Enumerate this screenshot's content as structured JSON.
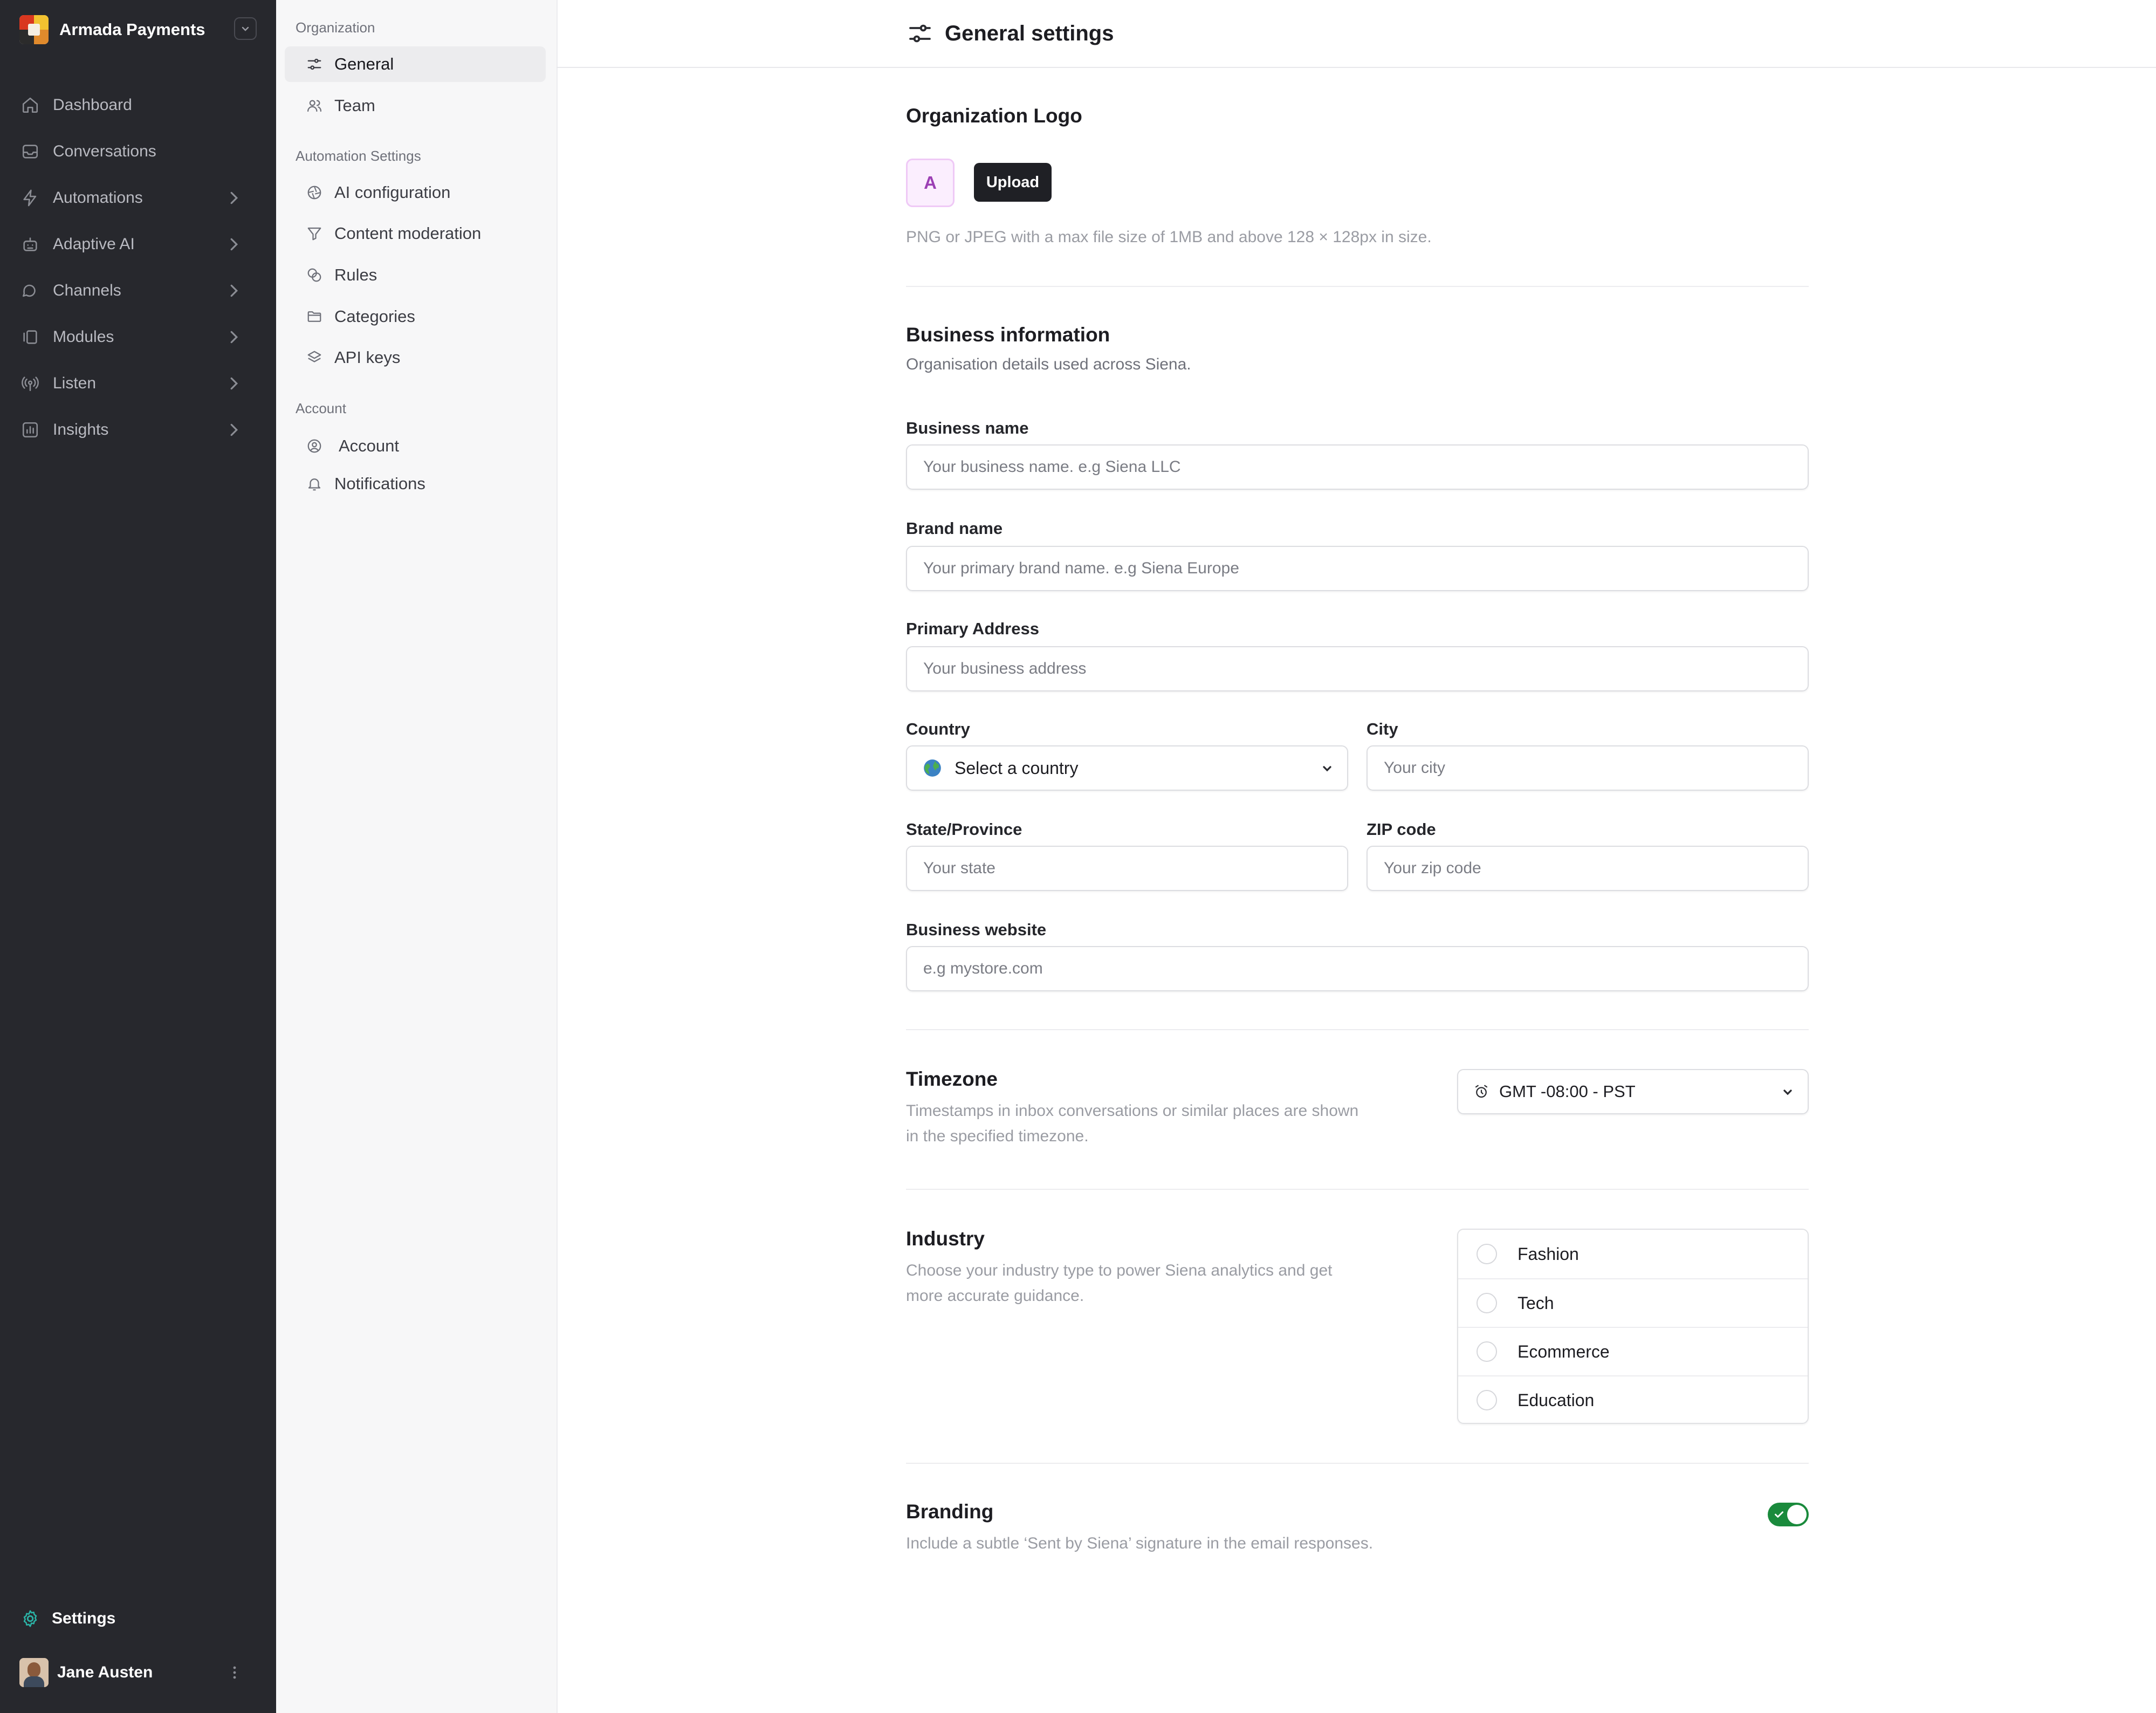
{
  "sidebar": {
    "org_name": "Armada Payments",
    "nav": [
      {
        "label": "Dashboard",
        "icon": "home-icon",
        "has_submenu": false
      },
      {
        "label": "Conversations",
        "icon": "inbox-icon",
        "has_submenu": false
      },
      {
        "label": "Automations",
        "icon": "bolt-icon",
        "has_submenu": true
      },
      {
        "label": "Adaptive AI",
        "icon": "robot-icon",
        "has_submenu": true
      },
      {
        "label": "Channels",
        "icon": "chat-bubbles-icon",
        "has_submenu": true
      },
      {
        "label": "Modules",
        "icon": "modules-icon",
        "has_submenu": true
      },
      {
        "label": "Listen",
        "icon": "broadcast-icon",
        "has_submenu": true
      },
      {
        "label": "Insights",
        "icon": "chart-icon",
        "has_submenu": true
      }
    ],
    "settings_label": "Settings",
    "user_name": "Jane Austen"
  },
  "subnav": {
    "sections": [
      {
        "title": "Organization",
        "items": [
          {
            "label": "General",
            "icon": "sliders-icon",
            "active": true
          },
          {
            "label": "Team",
            "icon": "users-icon",
            "active": false
          }
        ]
      },
      {
        "title": "Automation Settings",
        "items": [
          {
            "label": "AI configuration",
            "icon": "aperture-icon",
            "active": false
          },
          {
            "label": "Content moderation",
            "icon": "filter-icon",
            "active": false
          },
          {
            "label": "Rules",
            "icon": "link-icon",
            "active": false
          },
          {
            "label": "Categories",
            "icon": "folder-icon",
            "active": false
          },
          {
            "label": "API keys",
            "icon": "layers-icon",
            "active": false
          }
        ]
      },
      {
        "title": "Account",
        "items": [
          {
            "label": "Account",
            "icon": "user-circle-icon",
            "active": false
          },
          {
            "label": "Notifications",
            "icon": "bell-icon",
            "active": false
          }
        ]
      }
    ]
  },
  "header": {
    "title": "General settings"
  },
  "logo_section": {
    "title": "Organization Logo",
    "placeholder_letter": "A",
    "upload_label": "Upload",
    "hint": "PNG or JPEG with a max file size of 1MB and above 128 × 128px in size."
  },
  "business": {
    "title": "Business information",
    "subtitle": "Organisation details used across Siena.",
    "fields": {
      "business_name": {
        "label": "Business name",
        "placeholder": "Your business name. e.g Siena LLC",
        "value": ""
      },
      "brand_name": {
        "label": "Brand name",
        "placeholder": "Your primary brand name. e.g Siena Europe",
        "value": ""
      },
      "address": {
        "label": "Primary Address",
        "placeholder": "Your business address",
        "value": ""
      },
      "country": {
        "label": "Country",
        "value": "Select a country"
      },
      "city": {
        "label": "City",
        "placeholder": "Your city",
        "value": ""
      },
      "state": {
        "label": "State/Province",
        "placeholder": "Your state",
        "value": ""
      },
      "zip": {
        "label": "ZIP code",
        "placeholder": "Your zip code",
        "value": ""
      },
      "website": {
        "label": "Business website",
        "placeholder": "e.g mystore.com",
        "value": ""
      }
    }
  },
  "timezone": {
    "title": "Timezone",
    "description": "Timestamps in inbox conversations or similar places are shown in the specified timezone.",
    "value": "GMT -08:00 - PST"
  },
  "industry": {
    "title": "Industry",
    "description": "Choose your industry type to power Siena analytics and get more accurate guidance.",
    "options": [
      "Fashion",
      "Tech",
      "Ecommerce",
      "Education"
    ],
    "selected": null
  },
  "branding": {
    "title": "Branding",
    "description": "Include a subtle ‘Sent by Siena’ signature in the email responses.",
    "enabled": true
  },
  "colors": {
    "sidebar_bg": "#27282d",
    "toggle_on": "#1a8a3c",
    "accent_teal": "#2bb3a6"
  }
}
